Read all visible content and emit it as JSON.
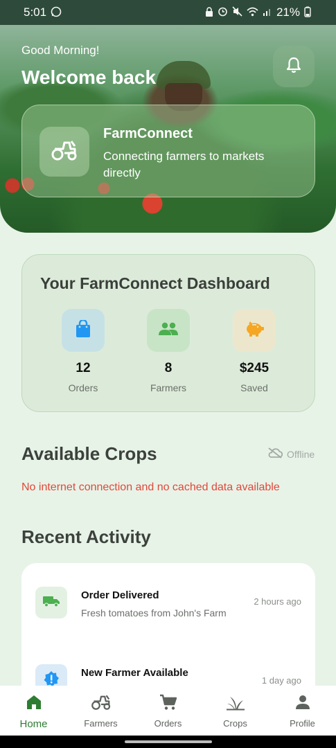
{
  "status_bar": {
    "time": "5:01",
    "battery": "21%"
  },
  "hero": {
    "greeting": "Good Morning!",
    "welcome": "Welcome back",
    "brand": "FarmConnect",
    "tagline": "Connecting farmers to markets directly"
  },
  "dashboard": {
    "title": "Your FarmConnect Dashboard",
    "stats": [
      {
        "value": "12",
        "label": "Orders",
        "icon": "shopping-bag-icon",
        "color": "#2196f3",
        "tile": "#c6e1e6"
      },
      {
        "value": "8",
        "label": "Farmers",
        "icon": "people-icon",
        "color": "#4caf50",
        "tile": "#c8e4c6"
      },
      {
        "value": "$245",
        "label": "Saved",
        "icon": "piggy-bank-icon",
        "color": "#f5a623",
        "tile": "#ece7cc"
      }
    ]
  },
  "crops": {
    "title": "Available Crops",
    "status": "Offline",
    "error": "No internet connection and no cached data available"
  },
  "activity": {
    "title": "Recent Activity",
    "items": [
      {
        "title": "Order Delivered",
        "subtitle": "Fresh tomatoes from John's Farm",
        "time": "2 hours ago",
        "icon": "truck-icon"
      },
      {
        "title": "New Farmer Available",
        "subtitle": "",
        "time": "1 day ago",
        "icon": "new-badge-icon"
      }
    ]
  },
  "nav": {
    "items": [
      {
        "label": "Home",
        "icon": "home-icon"
      },
      {
        "label": "Farmers",
        "icon": "tractor-icon"
      },
      {
        "label": "Orders",
        "icon": "cart-icon"
      },
      {
        "label": "Crops",
        "icon": "crops-icon"
      },
      {
        "label": "Profile",
        "icon": "person-icon"
      }
    ],
    "active": "Home"
  },
  "colors": {
    "primary": "#2e7d32",
    "error": "#e0483a",
    "background": "#e8f3e8"
  }
}
